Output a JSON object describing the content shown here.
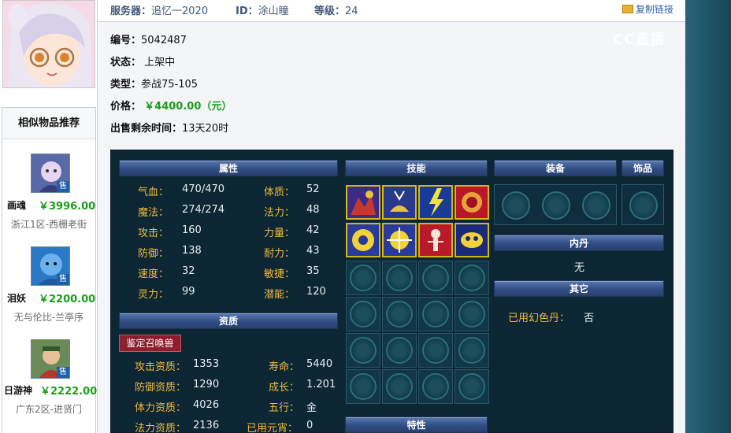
{
  "header": {
    "server_label": "服务器：",
    "server_value": "追忆一2020",
    "id_label": "ID：",
    "id_value": "涂山瞳",
    "level_label": "等级：",
    "level_value": "24",
    "copy_link": "复制链接"
  },
  "sidebar": {
    "title": "相似物品推荐",
    "items": [
      {
        "name": "画魂",
        "price": "￥3996.00",
        "server": "浙江1区-西栅老街",
        "tag": "售"
      },
      {
        "name": "泪妖",
        "price": "￥2200.00",
        "server": "无与伦比-兰亭序",
        "tag": "售"
      },
      {
        "name": "日游神",
        "price": "￥2222.00",
        "server": "广东2区-进贤门",
        "tag": "售"
      }
    ]
  },
  "info": {
    "id_label": "编号：",
    "id_value": "5042487",
    "status_label": "状态：",
    "status_value": "上架中",
    "type_label": "类型：",
    "type_value": "参战75-105",
    "price_label": "价格：",
    "price_value": "￥4400.00（元）",
    "time_label": "出售剩余时间：",
    "time_value": "13天20时"
  },
  "sections": {
    "attributes": "属性",
    "skills": "技能",
    "equipment": "装备",
    "ornament": "饰品",
    "neidan": "内丹",
    "neidan_value": "无",
    "other": "其它",
    "aptitude": "资质",
    "traits": "特性"
  },
  "attributes": [
    {
      "label": "气血：",
      "value": "470/470"
    },
    {
      "label": "体质：",
      "value": "52"
    },
    {
      "label": "魔法：",
      "value": "274/274"
    },
    {
      "label": "法力：",
      "value": "48"
    },
    {
      "label": "攻击：",
      "value": "160"
    },
    {
      "label": "力量：",
      "value": "42"
    },
    {
      "label": "防御：",
      "value": "138"
    },
    {
      "label": "耐力：",
      "value": "43"
    },
    {
      "label": "速度：",
      "value": "32"
    },
    {
      "label": "敏捷：",
      "value": "35"
    },
    {
      "label": "灵力：",
      "value": "99"
    },
    {
      "label": "潜能：",
      "value": "120"
    }
  ],
  "identify_button": "鉴定召唤兽",
  "aptitudes": [
    {
      "label": "攻击资质：",
      "value": "1353"
    },
    {
      "label": "寿命：",
      "value": "5440"
    },
    {
      "label": "防御资质：",
      "value": "1290"
    },
    {
      "label": "成长：",
      "value": "1.201"
    },
    {
      "label": "体力资质：",
      "value": "4026"
    },
    {
      "label": "五行：",
      "value": "金"
    },
    {
      "label": "法力资质：",
      "value": "2136"
    },
    {
      "label": "已用元宵：",
      "value": "0"
    }
  ],
  "other": {
    "label": "已用幻色丹：",
    "value": "否"
  },
  "watermark": "CC直播"
}
